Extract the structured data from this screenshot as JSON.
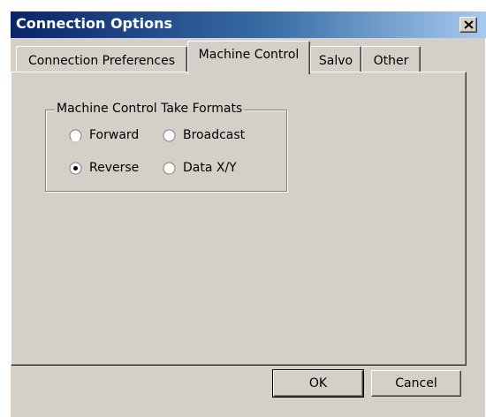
{
  "window": {
    "title": "Connection Options",
    "close_symbol": "close-icon"
  },
  "tabs": [
    {
      "label": "Connection Preferences",
      "active": false
    },
    {
      "label": "Machine Control",
      "active": true
    },
    {
      "label": "Salvo",
      "active": false
    },
    {
      "label": "Other",
      "active": false
    }
  ],
  "group": {
    "label": "Machine Control Take Formats",
    "options": [
      {
        "label": "Forward",
        "checked": false
      },
      {
        "label": "Broadcast",
        "checked": false
      },
      {
        "label": "Reverse",
        "checked": true
      },
      {
        "label": "Data X/Y",
        "checked": false
      }
    ]
  },
  "buttons": {
    "ok": "OK",
    "cancel": "Cancel"
  }
}
